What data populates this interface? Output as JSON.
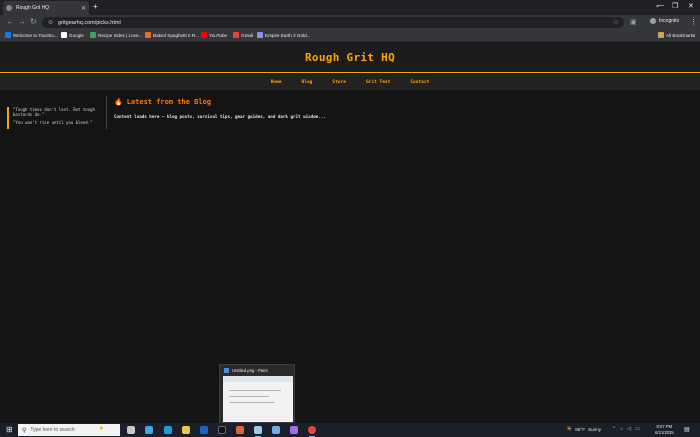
{
  "browser": {
    "tab_title": "Rough Grit HQ",
    "tab_close": "✕",
    "new_tab": "+",
    "url": "gritgearhq.com/picks.html",
    "incognito_label": "Incognito",
    "bookmarks": [
      {
        "label": "Welcome to Facebo...",
        "color": "#1877f2"
      },
      {
        "label": "Google",
        "color": "#ffffff"
      },
      {
        "label": "Recipe Index | Love...",
        "color": "#3aa55c"
      },
      {
        "label": "Baked Spaghetti II R...",
        "color": "#f26b21"
      },
      {
        "label": "YouTube",
        "color": "#ff0000"
      },
      {
        "label": "Gmail",
        "color": "#ea4335"
      },
      {
        "label": "Empire Earth 2 Gold...",
        "color": "#8e8ee0"
      }
    ],
    "all_bookmarks": "All Bookmarks"
  },
  "site": {
    "title": "Rough Grit HQ",
    "nav": [
      "Home",
      "Blog",
      "Store",
      "Grit Test",
      "Contact"
    ],
    "quotes": [
      "\"Tough times don't last. But tough bastards do.\"",
      "\"You won't rise until you bleed.\""
    ],
    "blog_icon": "🔥",
    "blog_title": "Latest from the Blog",
    "blog_desc": "Content loads here — blog posts, survival tips, gear guides, and dark grit wisdom..."
  },
  "paint_preview": {
    "title": "Untitled.png - Paint"
  },
  "taskbar": {
    "search_placeholder": "Type here to search",
    "temperature": "85°F",
    "weather": "Sunny",
    "time": "8:07 PM",
    "date": "6/21/2025"
  }
}
